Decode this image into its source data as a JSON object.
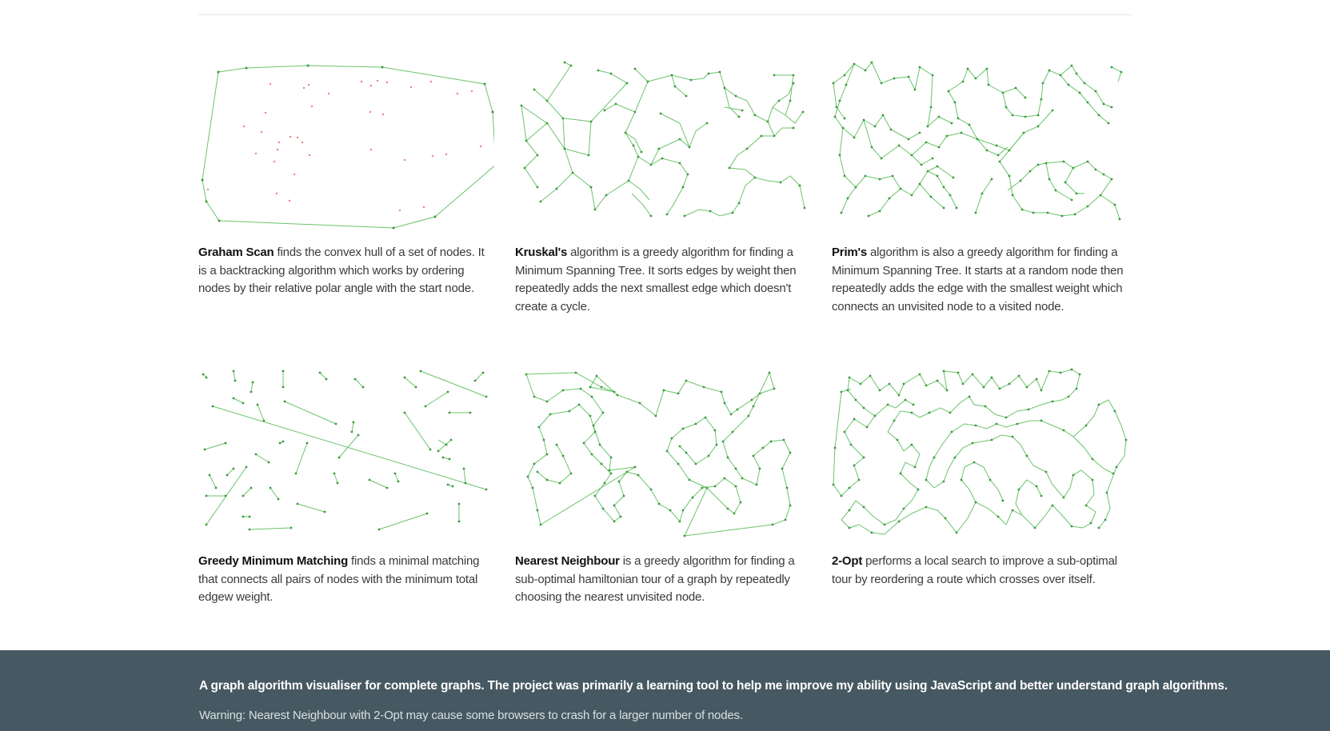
{
  "cards": [
    {
      "title": "Graham Scan",
      "text": " finds the convex hull of a set of nodes. It is a backtracking algorithm which works by ordering nodes by their relative polar angle with the start node."
    },
    {
      "title": "Kruskal's",
      "text": " algorithm is a greedy algorithm for finding a Minimum Spanning Tree. It sorts edges by weight then repeatedly adds the next smallest edge which doesn't create a cycle."
    },
    {
      "title": "Prim's",
      "text": " algorithm is also a greedy algorithm for finding a Minimum Spanning Tree. It starts at a random node then repeatedly adds the edge with the smallest weight which connects an unvisited node to a visited node."
    },
    {
      "title": "Greedy Minimum Matching",
      "text": " finds a minimal matching that connects all pairs of nodes with the minimum total edgew weight."
    },
    {
      "title": "Nearest Neighbour",
      "text": " is a greedy algorithm for finding a sub-optimal hamiltonian tour of a graph by repeatedly choosing the nearest unvisited node."
    },
    {
      "title": "2-Opt",
      "text": " performs a local search to improve a sub-optimal tour by reordering a route which crosses over itself."
    }
  ],
  "footer": {
    "about": "A graph algorithm visualiser for complete graphs. The project was primarily a learning tool to help me improve my ability using JavaScript and better understand graph algorithms.",
    "warning": "Warning: Nearest Neighbour with 2-Opt may cause some browsers to crash for a larger number of nodes."
  },
  "colors": {
    "edge": "#6cc36c",
    "node": "#3a9a3a",
    "interior": "#f08080",
    "footer_bg": "#465861"
  }
}
